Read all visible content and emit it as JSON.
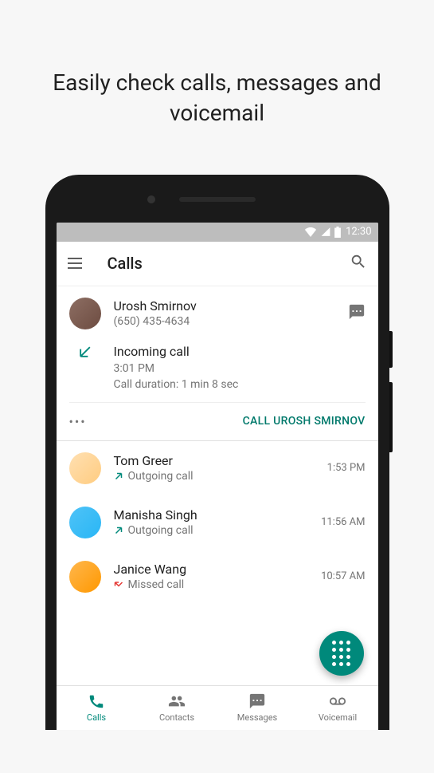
{
  "hero": "Easily check calls, messages and voicemail",
  "status": {
    "time": "12:30"
  },
  "appbar": {
    "title": "Calls"
  },
  "expanded": {
    "name": "Urosh Smirnov",
    "phone": "(650) 435-4634",
    "call_title": "Incoming call",
    "call_time": "3:01 PM",
    "call_duration": "Call duration: 1 min 8 sec",
    "action": "CALL UROSH SMIRNOV"
  },
  "calls": [
    {
      "name": "Tom Greer",
      "type": "Outgoing call",
      "time": "1:53 PM",
      "dir": "out"
    },
    {
      "name": "Manisha Singh",
      "type": "Outgoing call",
      "time": "11:56 AM",
      "dir": "out"
    },
    {
      "name": "Janice Wang",
      "type": "Missed call",
      "time": "10:57 AM",
      "dir": "missed"
    }
  ],
  "nav": {
    "calls": "Calls",
    "contacts": "Contacts",
    "messages": "Messages",
    "voicemail": "Voicemail"
  }
}
